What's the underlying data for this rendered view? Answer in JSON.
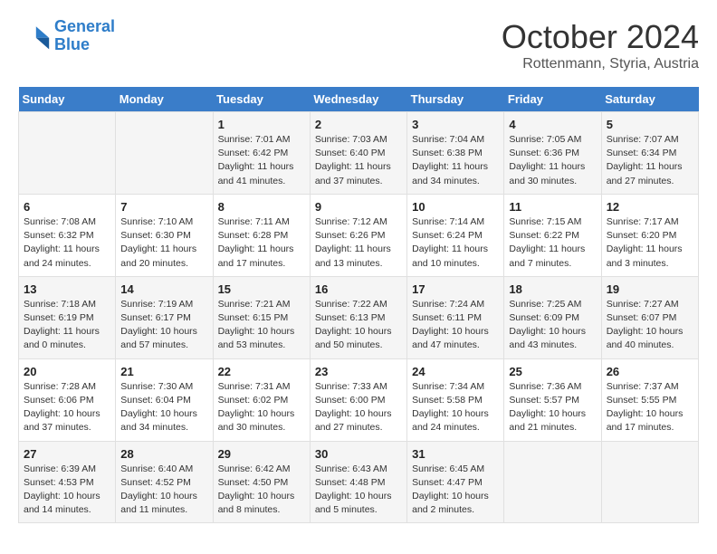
{
  "header": {
    "logo_line1": "General",
    "logo_line2": "Blue",
    "month": "October 2024",
    "location": "Rottenmann, Styria, Austria"
  },
  "weekdays": [
    "Sunday",
    "Monday",
    "Tuesday",
    "Wednesday",
    "Thursday",
    "Friday",
    "Saturday"
  ],
  "rows": [
    [
      {
        "day": "",
        "info": ""
      },
      {
        "day": "",
        "info": ""
      },
      {
        "day": "1",
        "info": "Sunrise: 7:01 AM\nSunset: 6:42 PM\nDaylight: 11 hours and 41 minutes."
      },
      {
        "day": "2",
        "info": "Sunrise: 7:03 AM\nSunset: 6:40 PM\nDaylight: 11 hours and 37 minutes."
      },
      {
        "day": "3",
        "info": "Sunrise: 7:04 AM\nSunset: 6:38 PM\nDaylight: 11 hours and 34 minutes."
      },
      {
        "day": "4",
        "info": "Sunrise: 7:05 AM\nSunset: 6:36 PM\nDaylight: 11 hours and 30 minutes."
      },
      {
        "day": "5",
        "info": "Sunrise: 7:07 AM\nSunset: 6:34 PM\nDaylight: 11 hours and 27 minutes."
      }
    ],
    [
      {
        "day": "6",
        "info": "Sunrise: 7:08 AM\nSunset: 6:32 PM\nDaylight: 11 hours and 24 minutes."
      },
      {
        "day": "7",
        "info": "Sunrise: 7:10 AM\nSunset: 6:30 PM\nDaylight: 11 hours and 20 minutes."
      },
      {
        "day": "8",
        "info": "Sunrise: 7:11 AM\nSunset: 6:28 PM\nDaylight: 11 hours and 17 minutes."
      },
      {
        "day": "9",
        "info": "Sunrise: 7:12 AM\nSunset: 6:26 PM\nDaylight: 11 hours and 13 minutes."
      },
      {
        "day": "10",
        "info": "Sunrise: 7:14 AM\nSunset: 6:24 PM\nDaylight: 11 hours and 10 minutes."
      },
      {
        "day": "11",
        "info": "Sunrise: 7:15 AM\nSunset: 6:22 PM\nDaylight: 11 hours and 7 minutes."
      },
      {
        "day": "12",
        "info": "Sunrise: 7:17 AM\nSunset: 6:20 PM\nDaylight: 11 hours and 3 minutes."
      }
    ],
    [
      {
        "day": "13",
        "info": "Sunrise: 7:18 AM\nSunset: 6:19 PM\nDaylight: 11 hours and 0 minutes."
      },
      {
        "day": "14",
        "info": "Sunrise: 7:19 AM\nSunset: 6:17 PM\nDaylight: 10 hours and 57 minutes."
      },
      {
        "day": "15",
        "info": "Sunrise: 7:21 AM\nSunset: 6:15 PM\nDaylight: 10 hours and 53 minutes."
      },
      {
        "day": "16",
        "info": "Sunrise: 7:22 AM\nSunset: 6:13 PM\nDaylight: 10 hours and 50 minutes."
      },
      {
        "day": "17",
        "info": "Sunrise: 7:24 AM\nSunset: 6:11 PM\nDaylight: 10 hours and 47 minutes."
      },
      {
        "day": "18",
        "info": "Sunrise: 7:25 AM\nSunset: 6:09 PM\nDaylight: 10 hours and 43 minutes."
      },
      {
        "day": "19",
        "info": "Sunrise: 7:27 AM\nSunset: 6:07 PM\nDaylight: 10 hours and 40 minutes."
      }
    ],
    [
      {
        "day": "20",
        "info": "Sunrise: 7:28 AM\nSunset: 6:06 PM\nDaylight: 10 hours and 37 minutes."
      },
      {
        "day": "21",
        "info": "Sunrise: 7:30 AM\nSunset: 6:04 PM\nDaylight: 10 hours and 34 minutes."
      },
      {
        "day": "22",
        "info": "Sunrise: 7:31 AM\nSunset: 6:02 PM\nDaylight: 10 hours and 30 minutes."
      },
      {
        "day": "23",
        "info": "Sunrise: 7:33 AM\nSunset: 6:00 PM\nDaylight: 10 hours and 27 minutes."
      },
      {
        "day": "24",
        "info": "Sunrise: 7:34 AM\nSunset: 5:58 PM\nDaylight: 10 hours and 24 minutes."
      },
      {
        "day": "25",
        "info": "Sunrise: 7:36 AM\nSunset: 5:57 PM\nDaylight: 10 hours and 21 minutes."
      },
      {
        "day": "26",
        "info": "Sunrise: 7:37 AM\nSunset: 5:55 PM\nDaylight: 10 hours and 17 minutes."
      }
    ],
    [
      {
        "day": "27",
        "info": "Sunrise: 6:39 AM\nSunset: 4:53 PM\nDaylight: 10 hours and 14 minutes."
      },
      {
        "day": "28",
        "info": "Sunrise: 6:40 AM\nSunset: 4:52 PM\nDaylight: 10 hours and 11 minutes."
      },
      {
        "day": "29",
        "info": "Sunrise: 6:42 AM\nSunset: 4:50 PM\nDaylight: 10 hours and 8 minutes."
      },
      {
        "day": "30",
        "info": "Sunrise: 6:43 AM\nSunset: 4:48 PM\nDaylight: 10 hours and 5 minutes."
      },
      {
        "day": "31",
        "info": "Sunrise: 6:45 AM\nSunset: 4:47 PM\nDaylight: 10 hours and 2 minutes."
      },
      {
        "day": "",
        "info": ""
      },
      {
        "day": "",
        "info": ""
      }
    ]
  ]
}
